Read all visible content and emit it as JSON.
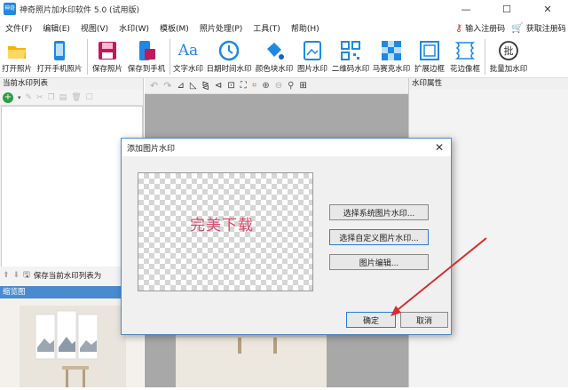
{
  "window": {
    "title": "神奇照片加水印软件 5.0 (试用版)",
    "app_icon_text": "神奇",
    "minimize": "—",
    "maximize": "☐",
    "close": "✕"
  },
  "menu": [
    "文件(F)",
    "编辑(E)",
    "视图(V)",
    "水印(W)",
    "模板(M)",
    "照片处理(P)",
    "工具(T)",
    "帮助(H)"
  ],
  "register": {
    "enter": "输入注册码",
    "get": "获取注册码"
  },
  "toolbar": [
    {
      "label": "打开照片",
      "icon": "folder-icon"
    },
    {
      "label": "打开手机照片",
      "icon": "phone-icon"
    },
    {
      "label": "保存照片",
      "icon": "save-icon"
    },
    {
      "label": "保存到手机",
      "icon": "save-phone-icon"
    },
    {
      "label": "文字水印",
      "icon": "text-icon"
    },
    {
      "label": "日期时间水印",
      "icon": "clock-icon"
    },
    {
      "label": "颜色块水印",
      "icon": "paint-bucket-icon"
    },
    {
      "label": "图片水印",
      "icon": "image-icon"
    },
    {
      "label": "二维码水印",
      "icon": "qrcode-icon"
    },
    {
      "label": "马赛克水印",
      "icon": "mosaic-icon"
    },
    {
      "label": "扩展边框",
      "icon": "border-icon"
    },
    {
      "label": "花边像框",
      "icon": "frame-icon"
    },
    {
      "label": "批量加水印",
      "icon": "batch-icon"
    }
  ],
  "batch_icon_text": "批",
  "left_panel": {
    "title": "当前水印列表",
    "save_label": "保存当前水印列表为",
    "thumb_title": "缩览图"
  },
  "right_panel": {
    "title": "水印属性"
  },
  "dialog": {
    "title": "添加图片水印",
    "close": "✕",
    "watermark_text": "完美下载",
    "buttons": {
      "system": "选择系统图片水印...",
      "custom": "选择自定义图片水印...",
      "edit": "图片编辑...",
      "ok": "确定",
      "cancel": "取消"
    }
  },
  "colors": {
    "accent": "#4a8bd0",
    "arrow": "#d62e2e",
    "watermark": "#d94a6a"
  }
}
